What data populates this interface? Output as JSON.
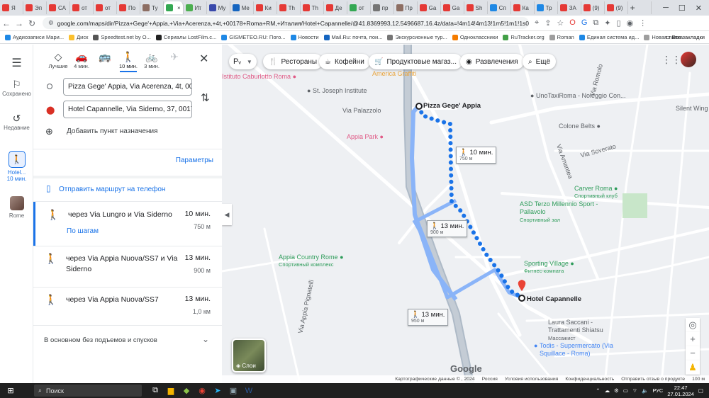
{
  "browser": {
    "tabs": [
      {
        "label": "Я",
        "color": "#e53935"
      },
      {
        "label": "Эп",
        "color": "#e53935"
      },
      {
        "label": "СА",
        "color": "#e53935"
      },
      {
        "label": "от",
        "color": "#e53935"
      },
      {
        "label": "от",
        "color": "#e53935"
      },
      {
        "label": "По",
        "color": "#e53935"
      },
      {
        "label": "Ту",
        "color": "#8d6e63"
      },
      {
        "label": "",
        "color": "#34a853",
        "active": true
      },
      {
        "label": "Ит",
        "color": "#4caf50"
      },
      {
        "label": "Му",
        "color": "#3949ab"
      },
      {
        "label": "Ме",
        "color": "#1565c0"
      },
      {
        "label": "Ки",
        "color": "#e53935"
      },
      {
        "label": "Th",
        "color": "#e53935"
      },
      {
        "label": "Th",
        "color": "#e53935"
      },
      {
        "label": "Де",
        "color": "#e53935"
      },
      {
        "label": "от",
        "color": "#34a853"
      },
      {
        "label": "пр",
        "color": "#757575"
      },
      {
        "label": "Пр",
        "color": "#8d6e63"
      },
      {
        "label": "Ga",
        "color": "#e53935"
      },
      {
        "label": "Ga",
        "color": "#e53935"
      },
      {
        "label": "Sh",
        "color": "#e53935"
      },
      {
        "label": "Сп",
        "color": "#1e88e5"
      },
      {
        "label": "Ка",
        "color": "#e53935"
      },
      {
        "label": "Тр",
        "color": "#1e88e5"
      },
      {
        "label": "ЗА",
        "color": "#e53935"
      },
      {
        "label": "(9)",
        "color": "#e53935"
      },
      {
        "label": "(9)",
        "color": "#e53935"
      }
    ],
    "tab_close": "×",
    "new_tab": "+",
    "url": "google.com/maps/dir/Pizza+Gege'+Appia,+Via+Acerenza,+4t,+00178+Roma+RM,+Италия/Hotel+Capannelle/@41.8369993,12.5496687,16.4z/data=!4m14!4m13!1m5!1m1!1s0x1325890b3bf6370d:0x835..."
  },
  "bookmarks": [
    {
      "label": "Аудиозаписи Мари...",
      "color": "#1e88e5"
    },
    {
      "label": "Диск",
      "color": "#fbc02d"
    },
    {
      "label": "Speedtest.net by O...",
      "color": "#555555"
    },
    {
      "label": "Сериалы LostFilm.c...",
      "color": "#222222"
    },
    {
      "label": "GISMETEO.RU: Пого...",
      "color": "#1e88e5"
    },
    {
      "label": "Новости",
      "color": "#1e88e5"
    },
    {
      "label": "Mail.Ru: почта, пои...",
      "color": "#1565c0"
    },
    {
      "label": "Экскурсионные тур...",
      "color": "#757575"
    },
    {
      "label": "Одноклассники",
      "color": "#f57c00"
    },
    {
      "label": "RuTracker.org",
      "color": "#43a047"
    },
    {
      "label": "Roman",
      "color": "#9e9e9e"
    },
    {
      "label": "Единая система ид...",
      "color": "#1e88e5"
    },
    {
      "label": "Новая папка",
      "color": "#9e9e9e"
    }
  ],
  "bookmarks_all": "Все закладки",
  "rail": {
    "saved": "Сохранено",
    "recent": "Недавние",
    "active_mode": "Hotel...",
    "active_time": "10 мин.",
    "recent_place": "Rome"
  },
  "modes": [
    {
      "label": "Лучшие",
      "icon": "◇"
    },
    {
      "label": "4 мин.",
      "icon": "🚗"
    },
    {
      "label": "",
      "icon": "🚌"
    },
    {
      "label": "10 мин.",
      "icon": "🚶"
    },
    {
      "label": "3 мин.",
      "icon": "🚲"
    },
    {
      "label": "",
      "icon": "✈"
    }
  ],
  "origin": "Pizza Gege' Appia, Via Acerenza, 4t, 0017",
  "destination": "Hotel Capannelle, Via Siderno, 37, 00178",
  "add_destination": "Добавить пункт назначения",
  "params": "Параметры",
  "send_to_phone": "Отправить маршрут на телефон",
  "routes": [
    {
      "via": "через Via Lungro и Via Siderno",
      "time": "10 мин.",
      "dist": "750 м",
      "details": "По шагам"
    },
    {
      "via": "через Via Appia Nuova/SS7 и Via Siderno",
      "time": "13 мин.",
      "dist": "900 м",
      "details": ""
    },
    {
      "via": "через Via Appia Nuova/SS7",
      "time": "13 мин.",
      "dist": "1,0 км",
      "details": ""
    }
  ],
  "no_slopes": "В основном без подъемов и спусков",
  "map": {
    "chips": [
      "Рестораны",
      "Кофейни",
      "Продуктовые магаз...",
      "Развлечения",
      "Ещё"
    ],
    "layers": "Слои",
    "pois": {
      "caburlotto": "Istituto Caburlotto Roma",
      "graffiti": "America Graffiti",
      "joseph": "St. Joseph Institute",
      "palazzolo": "Via Palazzolo",
      "taxi": "UnoTaxiRoma - Noleggio Con...",
      "silent": "Silent Wing",
      "colone": "Colone Belts",
      "soverato": "Via Soverato",
      "amantea": "Via Amantea",
      "romulo": "Via Romolo",
      "appia_park": "Appia Park",
      "carver": "Carver Roma",
      "carver_sub": "Спортивный клуб",
      "asd": "ASD Terzo Millennio Sport - Pallavolo",
      "asd_sub": "Спортивный зал",
      "country": "Appia Country Rome",
      "country_sub": "Спортивный комплекс",
      "sporting": "Sporting Village",
      "sporting_sub": "Фитнес-комната",
      "laura": "Laura Saccani - Trattamenti Shiatsu",
      "laura_sub": "Массажист",
      "todis": "Todis - Supermercato (Via Squillace - Roma)",
      "pignatelli": "Via Appia Pignatelli",
      "origin": "Pizza Gege' Appia",
      "dest": "Hotel Capannelle",
      "google": "Google"
    },
    "route_labels": [
      {
        "time": "10 мин.",
        "dist": "750 м"
      },
      {
        "time": "13 мин.",
        "dist": "900 м"
      },
      {
        "time": "13 мин.",
        "dist": "950 м"
      }
    ],
    "footer": [
      "Картографические данные © , 2024",
      "Россия",
      "Условия использования",
      "Конфиденциальность",
      "Отправить отзыв о продукте",
      "100 м"
    ]
  },
  "taskbar": {
    "search": "Поиск",
    "lang": "РУС",
    "time": "22:47",
    "date": "27.01.2024"
  },
  "colors": {
    "accent": "#1a73e8",
    "route": "#4285f4",
    "route_alt": "#8ab4f8",
    "poi_pink": "#e05a86",
    "poi_green": "#2e9c5a",
    "poi_blue": "#4285f4"
  }
}
